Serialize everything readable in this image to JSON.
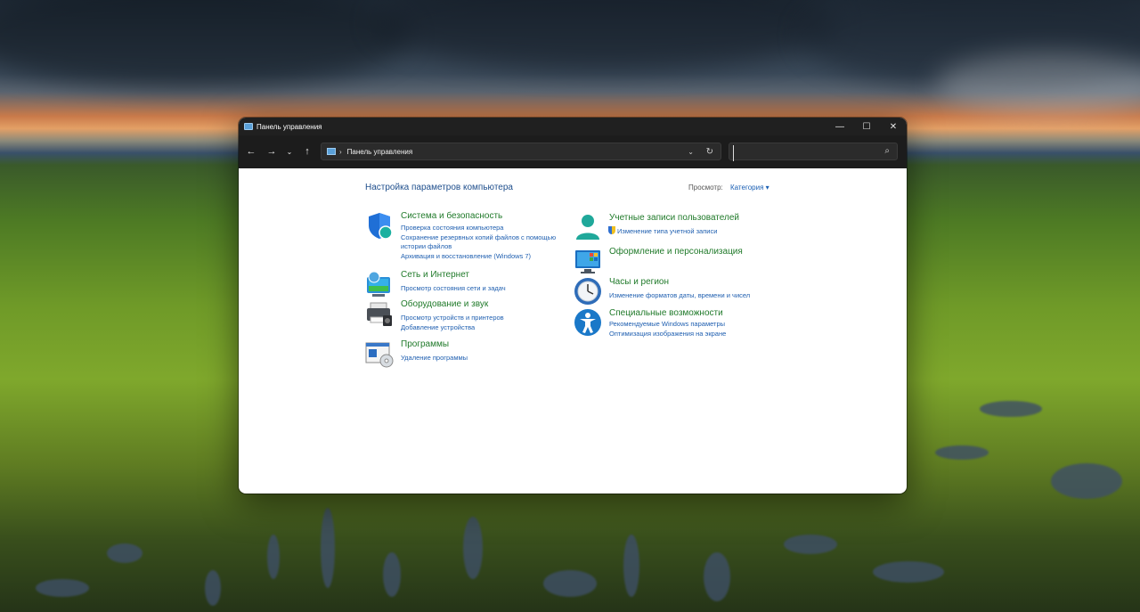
{
  "window": {
    "title": "Панель управления",
    "controls": {
      "minimize": "—",
      "maximize": "☐",
      "close": "✕"
    }
  },
  "toolbar": {
    "address": "Панель управления",
    "separator": "›",
    "search_placeholder": ""
  },
  "content": {
    "heading": "Настройка параметров компьютера",
    "view_by_label": "Просмотр:",
    "view_by_value": "Категория ▾",
    "left": [
      {
        "title": "Система и безопасность",
        "icon": "shield-icon",
        "links": [
          "Проверка состояния компьютера",
          "Сохранение резервных копий файлов с помощью",
          "истории файлов",
          "Архивация и восстановление (Windows 7)"
        ]
      },
      {
        "title": "Сеть и Интернет",
        "icon": "network-globe-icon",
        "links": [
          "Просмотр состояния сети и задач"
        ]
      },
      {
        "title": "Оборудование и звук",
        "icon": "printer-icon",
        "links": [
          "Просмотр устройств и принтеров",
          "Добавление устройства"
        ]
      },
      {
        "title": "Программы",
        "icon": "programs-disc-icon",
        "links": [
          "Удаление программы"
        ]
      }
    ],
    "right": [
      {
        "title": "Учетные записи пользователей",
        "icon": "user-accounts-icon",
        "links": [
          "Изменение типа учетной записи"
        ]
      },
      {
        "title": "Оформление и персонализация",
        "icon": "personalization-monitor-icon",
        "links": []
      },
      {
        "title": "Часы и регион",
        "icon": "clock-globe-icon",
        "links": [
          "Изменение форматов даты, времени и чисел"
        ]
      },
      {
        "title": "Специальные возможности",
        "icon": "accessibility-icon",
        "links": [
          "Рекомендуемые Windows параметры",
          "Оптимизация изображения на экране"
        ]
      }
    ]
  },
  "colors": {
    "title_green": "#207a2a",
    "link_blue": "#1f5fb0",
    "heading_blue": "#1e4e8c"
  }
}
